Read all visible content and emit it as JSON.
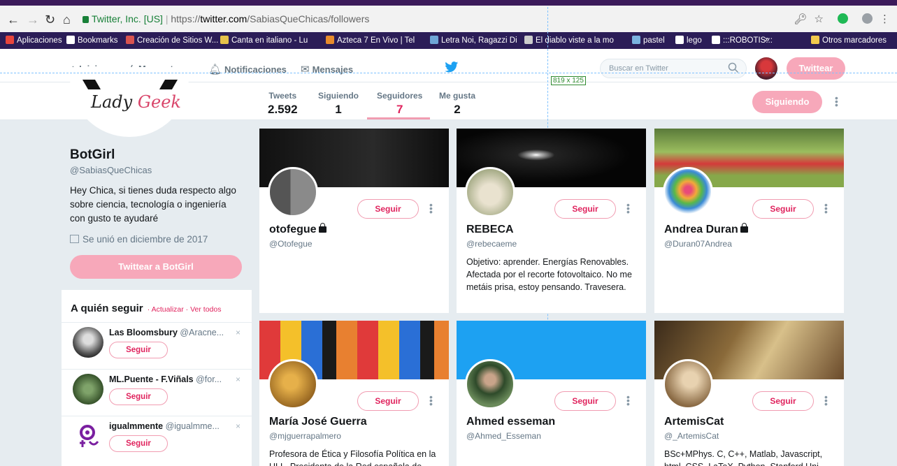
{
  "browser": {
    "url_secure_label": "Twitter, Inc. [US]",
    "url_prefix": "https://",
    "url_host": "twitter.com",
    "url_path": "/SabiasQueChicas/followers",
    "bookmarks": [
      {
        "label": "Aplicaciones",
        "color": "#e8453c"
      },
      {
        "label": "Bookmarks",
        "color": "#ffffff"
      },
      {
        "label": "Creación de Sitios W...",
        "color": "#d9534f"
      },
      {
        "label": "Canta en italiano - Lu",
        "color": "#e6c24a"
      },
      {
        "label": "Azteca 7 En Vivo | Tel",
        "color": "#e88b2c"
      },
      {
        "label": "Letra Noi, Ragazzi Di",
        "color": "#6fa6d6"
      },
      {
        "label": "El diablo viste a la mo",
        "color": "#cccccc"
      },
      {
        "label": "pastel",
        "color": "#7ab3e0"
      },
      {
        "label": "lego",
        "color": "#ffffff"
      },
      {
        "label": ":::ROBOTIS:::",
        "color": "#ffffff"
      },
      {
        "label": "»",
        "color": ""
      },
      {
        "label": "Otros marcadores",
        "color": "#f2c94c"
      }
    ]
  },
  "header": {
    "nav": [
      "Inicio",
      "Momentos",
      "Notificaciones",
      "Mensajes"
    ],
    "search_placeholder": "Buscar en Twitter",
    "tweet_button": "Twittear",
    "dimension_badge": "819 x 125"
  },
  "logo": {
    "lady": "Lady",
    "geek": "Geek"
  },
  "stats": [
    {
      "label": "Tweets",
      "value": "2.592"
    },
    {
      "label": "Siguiendo",
      "value": "1"
    },
    {
      "label": "Seguidores",
      "value": "7"
    },
    {
      "label": "Me gusta",
      "value": "2"
    }
  ],
  "following_button": "Siguiendo",
  "profile": {
    "name": "BotGirl",
    "handle": "@SabiasQueChicas",
    "bio": "Hey Chica, si tienes duda respecto algo sobre ciencia, tecnología o ingeniería con gusto te ayudaré",
    "joined": "Se unió en diciembre de 2017",
    "tweet_to": "Twittear a BotGirl"
  },
  "who_to_follow": {
    "title": "A quién seguir",
    "refresh": "Actualizar",
    "view_all": "Ver todos",
    "follow_label": "Seguir",
    "close": "×",
    "items": [
      {
        "name": "Las Bloomsbury",
        "handle": "@Aracne..."
      },
      {
        "name": "ML.Puente - F.Viñals",
        "handle": "@for..."
      },
      {
        "name": "igualmmente",
        "handle": "@igualmme..."
      }
    ]
  },
  "follow_label": "Seguir",
  "followers": [
    {
      "name": "otofegue",
      "handle": "@Otofegue",
      "bio": "",
      "locked": true
    },
    {
      "name": "REBECA",
      "handle": "@rebecaeme",
      "bio": "Objetivo: aprender. Energías Renovables. Afectada por el recorte fotovoltaico. No me metáis prisa, estoy pensando. Travesera.",
      "locked": false
    },
    {
      "name": "Andrea Duran",
      "handle": "@Duran07Andrea",
      "bio": "",
      "locked": true
    },
    {
      "name": "María José Guerra",
      "handle": "@mjguerrapalmero",
      "bio": "Profesora de Ética y Filosofía Política en la ULL. Presidenta de la Red española de",
      "locked": false
    },
    {
      "name": "Ahmed esseman",
      "handle": "@Ahmed_Esseman",
      "bio": "",
      "locked": false
    },
    {
      "name": "ArtemisCat",
      "handle": "@_ArtemisCat",
      "bio": "BSc+MPhys. C, C++, Matlab, Javascript, html, CSS, LaTeX, Python, Stanford Uni",
      "locked": false
    }
  ],
  "colors": {
    "accent_pink": "#f7a8ba",
    "twitter_blue": "#1da1f2"
  }
}
